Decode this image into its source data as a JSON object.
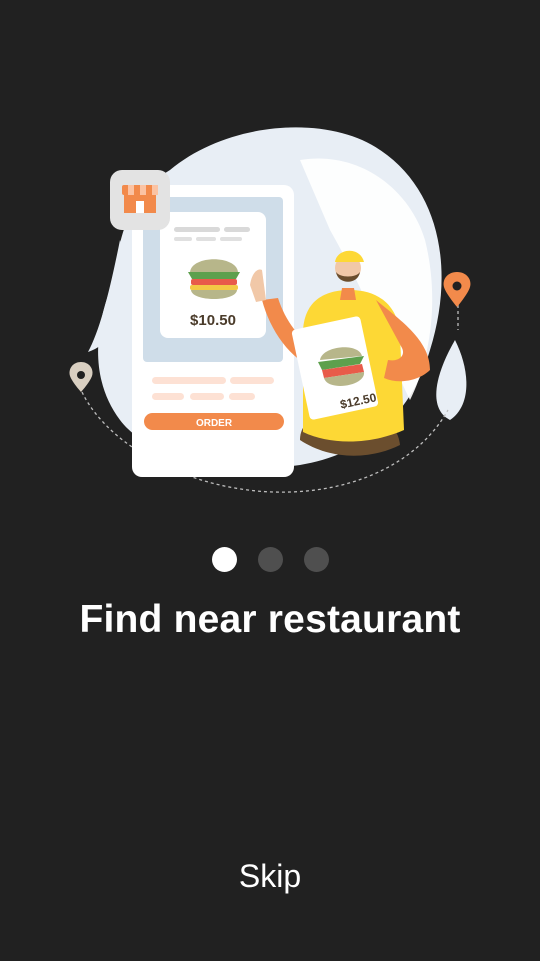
{
  "illustration": {
    "price_main": "$10.50",
    "price_menu": "$12.50",
    "order_label": "ORDER"
  },
  "pagination": {
    "total": 3,
    "active_index": 0
  },
  "title": "Find near restaurant",
  "skip_label": "Skip",
  "colors": {
    "background": "#212121",
    "accent": "#f28a4b",
    "dot_active": "#ffffff",
    "dot_inactive": "#4f4f4f"
  }
}
